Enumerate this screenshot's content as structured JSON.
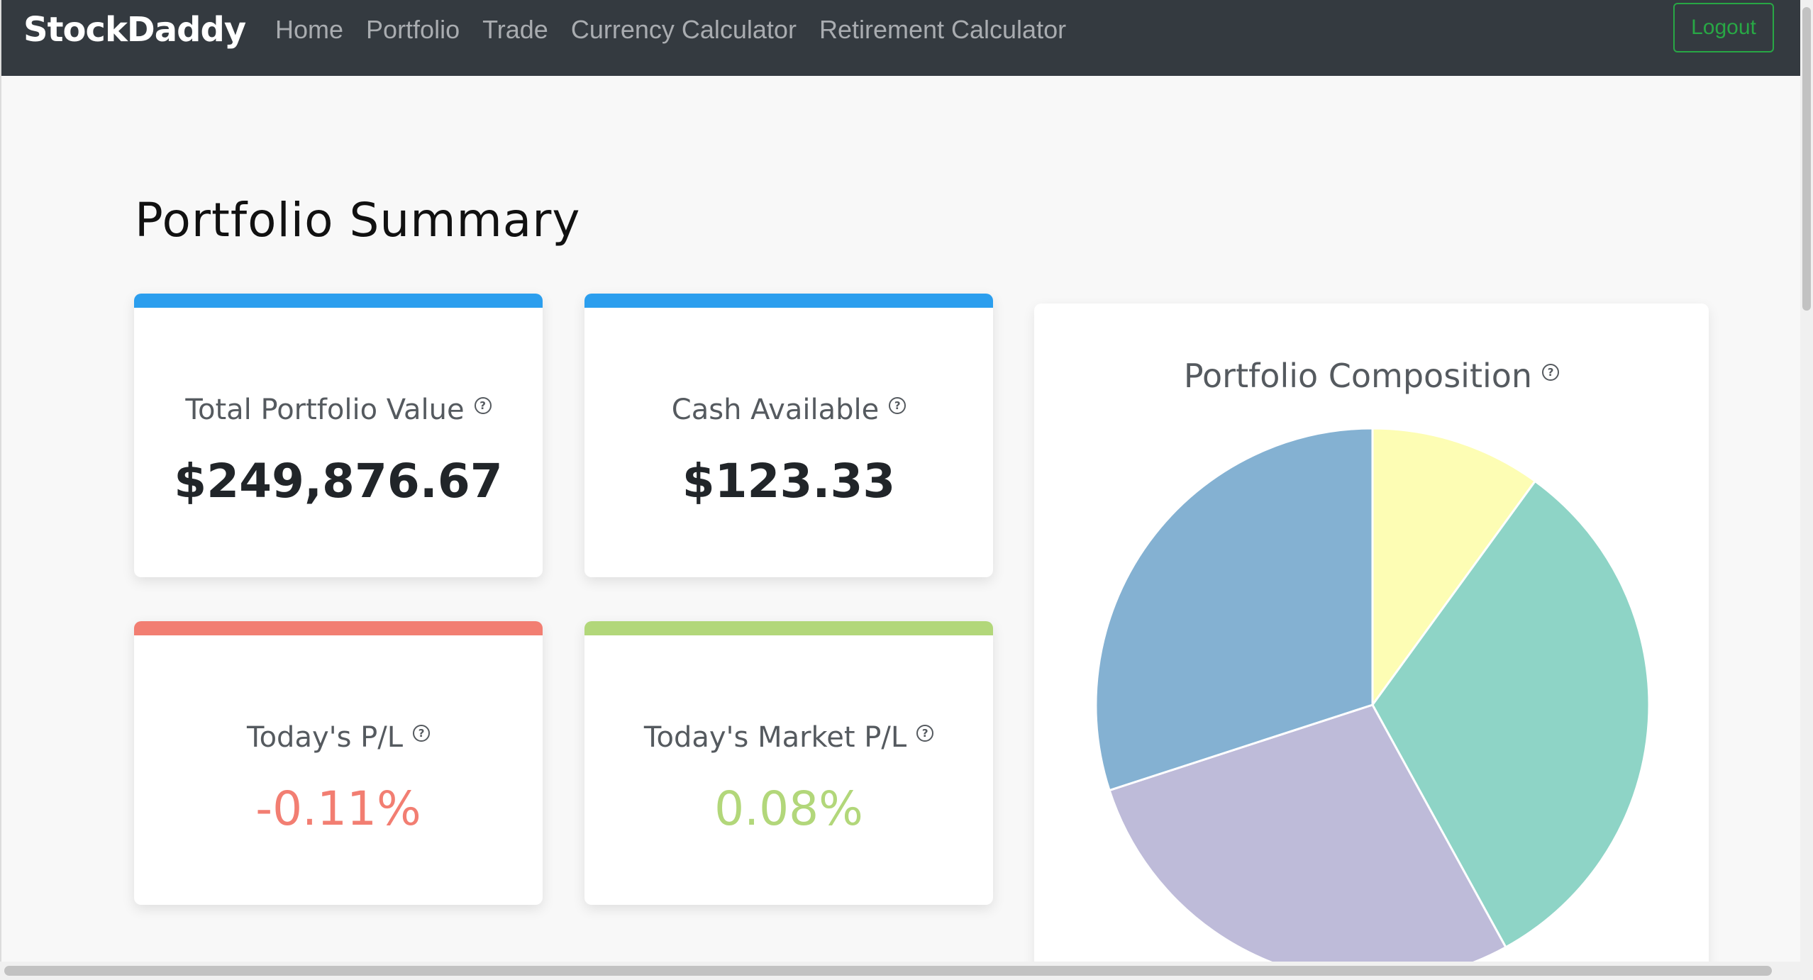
{
  "navbar": {
    "brand": "StockDaddy",
    "links": [
      "Home",
      "Portfolio",
      "Trade",
      "Currency Calculator",
      "Retirement Calculator"
    ],
    "logout_label": "Logout"
  },
  "page": {
    "title": "Portfolio Summary"
  },
  "cards": {
    "total_value": {
      "label": "Total Portfolio Value",
      "value": "$249,876.67",
      "accent": "#2b9eee"
    },
    "cash": {
      "label": "Cash Available",
      "value": "$123.33",
      "accent": "#2b9eee"
    },
    "today_pl": {
      "label": "Today's P/L",
      "value": "-0.11%",
      "accent": "#f27e72",
      "value_color": "#f27e72"
    },
    "market_pl": {
      "label": "Today's Market P/L",
      "value": "0.08%",
      "accent": "#b2d77a",
      "value_color": "#b2d77a"
    }
  },
  "help_icon": "question-circle-icon",
  "chart_data": {
    "type": "pie",
    "title": "Portfolio Composition",
    "values": [
      10,
      32,
      28,
      30
    ],
    "colors": [
      "#fdfdb4",
      "#8ed4c6",
      "#bebbd9",
      "#84b1d2"
    ]
  }
}
